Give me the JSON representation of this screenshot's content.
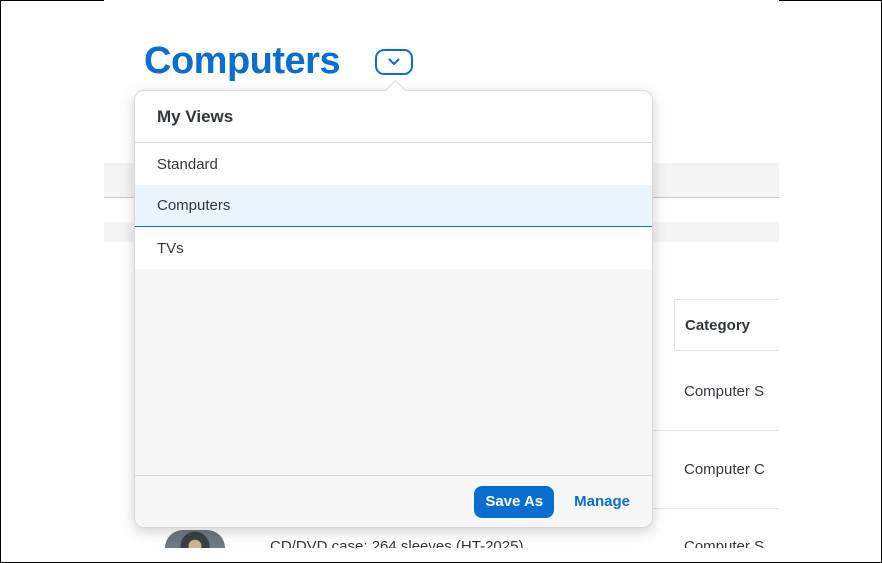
{
  "page": {
    "title": "Computers"
  },
  "variant_popover": {
    "header": "My Views",
    "items": [
      {
        "label": "Standard",
        "selected": false
      },
      {
        "label": "Computers",
        "selected": true
      },
      {
        "label": "TVs",
        "selected": false
      }
    ],
    "footer": {
      "save_as_label": "Save As",
      "manage_label": "Manage"
    }
  },
  "background_table": {
    "column_header": "Category",
    "rows": [
      {
        "category": "Computer S"
      },
      {
        "category": "Computer C"
      },
      {
        "category": "Computer S",
        "product": "CD/DVD case: 264 sleeves (HT-2025)"
      }
    ]
  },
  "icons": {
    "variant_toggle": "chevron-down-icon"
  },
  "colors": {
    "accent": "#0a6ed1",
    "selected_row_bg": "#eaf4fc"
  }
}
